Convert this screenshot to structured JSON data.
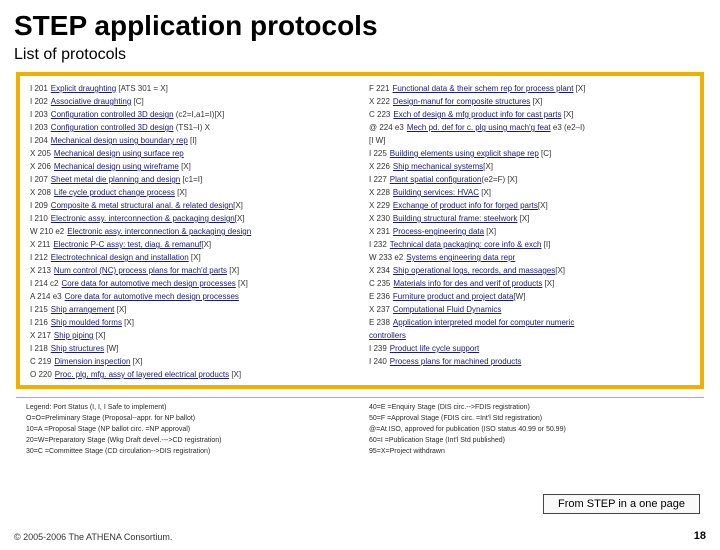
{
  "title": "STEP application protocols",
  "subtitle": "List of protocols",
  "left_rows": [
    {
      "code": "I 201",
      "name": "Explicit draughting",
      "suffix": " [ATS 301 = X]"
    },
    {
      "code": "I 202",
      "name": "Associative draughting",
      "suffix": " [C]"
    },
    {
      "code": "I 203",
      "name": "Configuration controlled 3D design",
      "suffix": " (c2=I,a1=I)[X]"
    },
    {
      "code": "I 203",
      "name": "Configuration controlled 3D design",
      "suffix": " (TS1–I) X"
    },
    {
      "code": "I 204",
      "name": "Mechanical design using boundary rep",
      "suffix": " [I]"
    },
    {
      "code": "X 205",
      "name": "Mechanical design using surface rep",
      "suffix": ""
    },
    {
      "code": "X 206",
      "name": "Mechanical design using wireframe",
      "suffix": " [X]"
    },
    {
      "code": "I 207",
      "name": "Sheet metal die planning and design",
      "suffix": " [c1=I]"
    },
    {
      "code": "X 208",
      "name": "Life cycle product change process",
      "suffix": " [X]"
    },
    {
      "code": "I 209",
      "name": "Composite & metal structural anal. & related design",
      "suffix": "[X]"
    },
    {
      "code": "I 210",
      "name": "Electronic assy. interconnection & packaging design",
      "suffix": "[X]"
    },
    {
      "code": "W 210 e2",
      "name": "Electronic assy. interconnection & packaging design",
      "suffix": ""
    },
    {
      "code": "X 211",
      "name": "Electronic P-C assy: test, diag. & remanuf",
      "suffix": "[X]"
    },
    {
      "code": "I 212",
      "name": "Electrotechnical design and installation",
      "suffix": " [X]"
    },
    {
      "code": "X 213",
      "name": "Num control (NC) process plans for mach'd parts",
      "suffix": " [X]"
    },
    {
      "code": "I 214 c2",
      "name": "Core data for automotive mech design processes",
      "suffix": " [X]"
    },
    {
      "code": "A 214 e3",
      "name": "Core data for automotive mech design processes",
      "suffix": ""
    },
    {
      "code": "I 215",
      "name": "Ship arrangement",
      "suffix": " [X]"
    },
    {
      "code": "I 216",
      "name": "Ship moulded forms",
      "suffix": " [X]"
    },
    {
      "code": "X 217",
      "name": "Ship piping",
      "suffix": " [X]"
    },
    {
      "code": "I 218",
      "name": "Ship structures",
      "suffix": " [W]"
    },
    {
      "code": "C 219",
      "name": "Dimension inspection",
      "suffix": " [X]"
    },
    {
      "code": "O 220",
      "name": "Proc. plg, mfg. assy of layered electrical products",
      "suffix": " [X]"
    }
  ],
  "right_rows": [
    {
      "code": "F 221",
      "name": "Functional data & their schem rep for process plant",
      "suffix": " [X]"
    },
    {
      "code": "X 222",
      "name": "Design-manuf for composite structures",
      "suffix": " [X]"
    },
    {
      "code": "C 223",
      "name": "Exch of design & mfg product info for cast parts",
      "suffix": " [X]"
    },
    {
      "code": "@ 224 e3",
      "name": "Mech pd. def for c. plg using mach'g feat",
      "suffix": " e3 (e2–I)"
    },
    {
      "code": "",
      "name": "",
      "suffix": "[I W]"
    },
    {
      "code": "I 225",
      "name": "Building elements using explicit shape rep",
      "suffix": " [C]"
    },
    {
      "code": "X 226",
      "name": "Ship mechanical systems",
      "suffix": "[X]"
    },
    {
      "code": "I 227",
      "name": "Plant spatial configuration",
      "suffix": "(e2=F) [X]"
    },
    {
      "code": "X 228",
      "name": "Building services: HVAC",
      "suffix": " [X]"
    },
    {
      "code": "X 229",
      "name": "Exchange of product info for forged parts",
      "suffix": "[X]"
    },
    {
      "code": "X 230",
      "name": "Building structural frame: steelwork",
      "suffix": " [X]"
    },
    {
      "code": "X 231",
      "name": "Process-engineering data",
      "suffix": " [X]"
    },
    {
      "code": "I 232",
      "name": "Technical data packaging: core info & exch",
      "suffix": " [I]"
    },
    {
      "code": "W 233 e2",
      "name": "Systems engineering data repr",
      "suffix": ""
    },
    {
      "code": "X 234",
      "name": "Ship operational logs, records, and massages",
      "suffix": "[X]"
    },
    {
      "code": "C 235",
      "name": "Materials info for des and verif of products",
      "suffix": " [X]"
    },
    {
      "code": "E 236",
      "name": "Furniture product and project data",
      "suffix": "[W]"
    },
    {
      "code": "X 237",
      "name": "Computational Fluid Dynamics",
      "suffix": ""
    },
    {
      "code": "E 238",
      "name": "Application interpreted model for computer numeric",
      "suffix": ""
    },
    {
      "code": "",
      "name": "controllers",
      "suffix": ""
    },
    {
      "code": "I 239",
      "name": "Product life cycle support",
      "suffix": ""
    },
    {
      "code": "I 240",
      "name": "Process plans for machined products",
      "suffix": ""
    }
  ],
  "legend_left": [
    "Legend: Port Status (I, I, I Safe to implement)",
    "O=O=Preliminary Stage (Proposal--appr. for NP ballot)",
    "10=A =Proposal Stage (NP ballot circ. =NP approval)",
    "20=W=Preparatory Stage (Wkg Draft devel.--->CD registration)",
    "30=C =Committee Stage (CD circulation-->DIS registration)"
  ],
  "legend_right": [
    "40=E =Enquiry Stage (DIS circ.-->FDIS registration)",
    "50=F =Approval Stage (FDIS circ. =Int'l Std registration)",
    "@=At ISO, approved for publication (ISO status 40.99 or 50.99)",
    "60=I =Publication Stage (Int'l Std published)",
    "95=X=Project withdrawn"
  ],
  "source_label": "From STEP in a one page",
  "footer_left": "© 2005-2006 The ATHENA Consortium.",
  "page_number": "18"
}
